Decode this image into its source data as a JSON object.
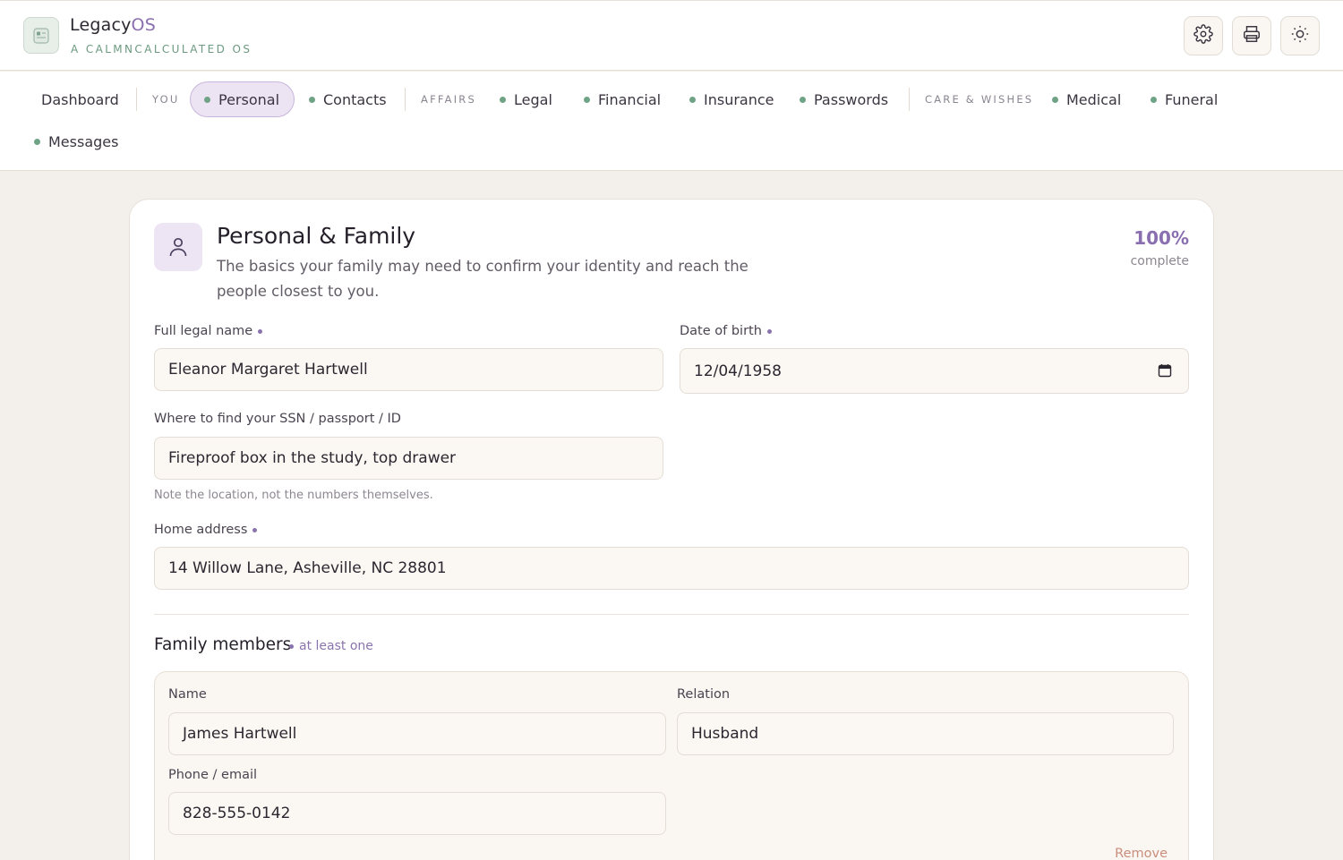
{
  "app": {
    "name_main": "Legacy",
    "name_accent": "OS",
    "tagline": "A CALMNCALCULATED OS",
    "logo_icon": "document-icon"
  },
  "header_buttons": [
    {
      "icon": "gear-icon",
      "label": "Settings"
    },
    {
      "icon": "printer-icon",
      "label": "Print"
    },
    {
      "icon": "sun-icon",
      "label": "Theme"
    }
  ],
  "nav": {
    "dashboard": "Dashboard",
    "groups": {
      "you": "YOU",
      "affairs": "AFFAIRS",
      "care": "CARE & WISHES"
    },
    "items": {
      "personal": "Personal",
      "contacts": "Contacts",
      "legal": "Legal",
      "financial": "Financial",
      "insurance": "Insurance",
      "passwords": "Passwords",
      "medical": "Medical",
      "funeral": "Funeral",
      "messages": "Messages"
    },
    "active": "Personal",
    "status_color": "#6ea385"
  },
  "section": {
    "icon": "person-icon",
    "title": "Personal & Family",
    "description": "The basics your family may need to confirm your identity and reach the people closest to you.",
    "completion_value": "100%",
    "completion_label": "complete"
  },
  "form": {
    "full_name": {
      "label": "Full legal name",
      "value": "Eleanor Margaret Hartwell",
      "required": true
    },
    "dob": {
      "label": "Date of birth",
      "value": "12/04/1958",
      "required": true
    },
    "id_location": {
      "label": "Where to find your SSN / passport / ID",
      "value": "Fireproof box in the study, top drawer",
      "hint": "Note the location, not the numbers themselves."
    },
    "address": {
      "label": "Home address",
      "value": "14 Willow Lane, Asheville, NC 28801",
      "required": true
    }
  },
  "family": {
    "title": "Family members",
    "requirement": "at least one",
    "members": [
      {
        "name_label": "Name",
        "name": "James Hartwell",
        "relation_label": "Relation",
        "relation": "Husband",
        "contact_label": "Phone / email",
        "contact": "828-555-0142",
        "remove_label": "Remove"
      }
    ]
  },
  "colors": {
    "accent": "#8a6fb0",
    "brand_green": "#6c9a80",
    "background": "#f3efea"
  }
}
